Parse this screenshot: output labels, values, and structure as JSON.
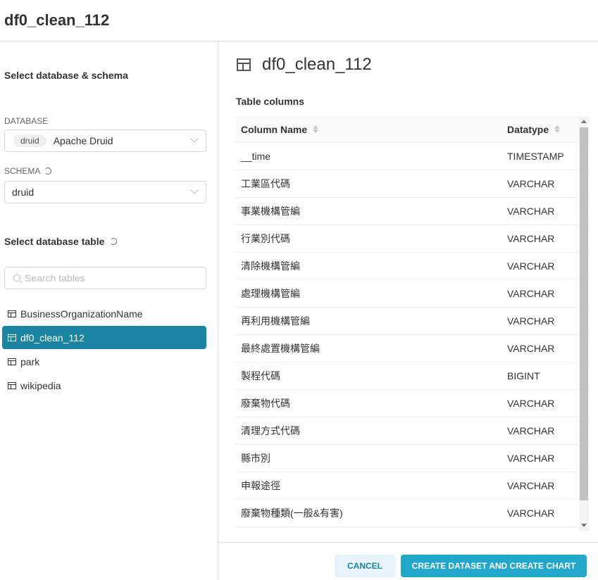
{
  "header": {
    "title": "df0_clean_112"
  },
  "left": {
    "select_db_schema_title": "Select database & schema",
    "database_label": "DATABASE",
    "database_tag": "druid",
    "database_value": "Apache Druid",
    "schema_label": "SCHEMA",
    "schema_value": "druid",
    "select_table_title": "Select database table",
    "search_placeholder": "Search tables",
    "tables": [
      "BusinessOrganizationName",
      "df0_clean_112",
      "park",
      "wikipedia"
    ],
    "selected_table": "df0_clean_112"
  },
  "main": {
    "title": "df0_clean_112",
    "columns_title": "Table columns",
    "col_header_name": "Column Name",
    "col_header_type": "Datatype",
    "rows": [
      {
        "name": "__time",
        "type": "TIMESTAMP"
      },
      {
        "name": "工業區代碼",
        "type": "VARCHAR"
      },
      {
        "name": "事業機構管編",
        "type": "VARCHAR"
      },
      {
        "name": "行業別代碼",
        "type": "VARCHAR"
      },
      {
        "name": "清除機構管編",
        "type": "VARCHAR"
      },
      {
        "name": "處理機構管編",
        "type": "VARCHAR"
      },
      {
        "name": "再利用機構管編",
        "type": "VARCHAR"
      },
      {
        "name": "最終處置機構管編",
        "type": "VARCHAR"
      },
      {
        "name": "製程代碼",
        "type": "BIGINT"
      },
      {
        "name": "廢棄物代碼",
        "type": "VARCHAR"
      },
      {
        "name": "清理方式代碼",
        "type": "VARCHAR"
      },
      {
        "name": "縣市別",
        "type": "VARCHAR"
      },
      {
        "name": "申報途徑",
        "type": "VARCHAR"
      },
      {
        "name": "廢棄物種類(一般&有害)",
        "type": "VARCHAR"
      }
    ]
  },
  "footer": {
    "cancel_label": "CANCEL",
    "create_label": "CREATE DATASET AND CREATE CHART"
  },
  "colors": {
    "accent": "#20a7c9",
    "selected": "#1a85a0"
  }
}
